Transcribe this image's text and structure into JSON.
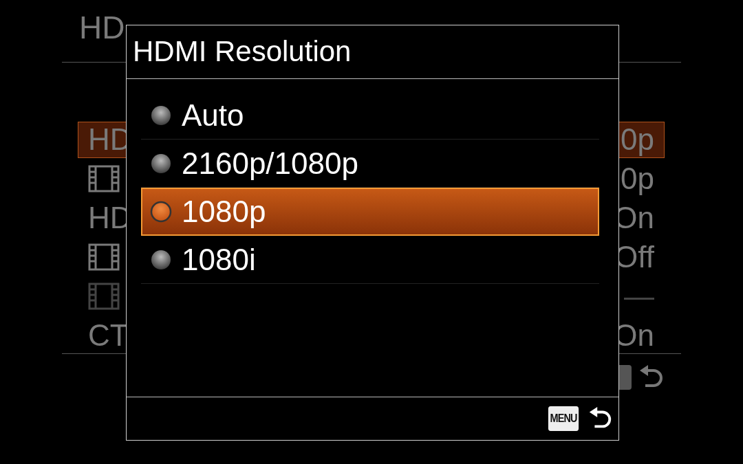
{
  "background": {
    "title": "HD",
    "rows": [
      {
        "kind": "text",
        "label": "HD",
        "value": "0p",
        "selected": true,
        "disabled": false
      },
      {
        "kind": "film",
        "value": "0p",
        "selected": false,
        "disabled": false
      },
      {
        "kind": "text",
        "label": "HD",
        "value": "On",
        "selected": false,
        "disabled": false
      },
      {
        "kind": "film",
        "value": "Off",
        "selected": false,
        "disabled": false
      },
      {
        "kind": "film",
        "value": "—",
        "selected": false,
        "disabled": true
      },
      {
        "kind": "text",
        "label": "CT",
        "value": "On",
        "selected": false,
        "disabled": false
      }
    ]
  },
  "dialog": {
    "title": "HDMI Resolution",
    "options": [
      {
        "label": "Auto",
        "selected": false
      },
      {
        "label": "2160p/1080p",
        "selected": false
      },
      {
        "label": "1080p",
        "selected": true
      },
      {
        "label": "1080i",
        "selected": false
      }
    ],
    "footer": {
      "menu_key": "MENU"
    }
  }
}
